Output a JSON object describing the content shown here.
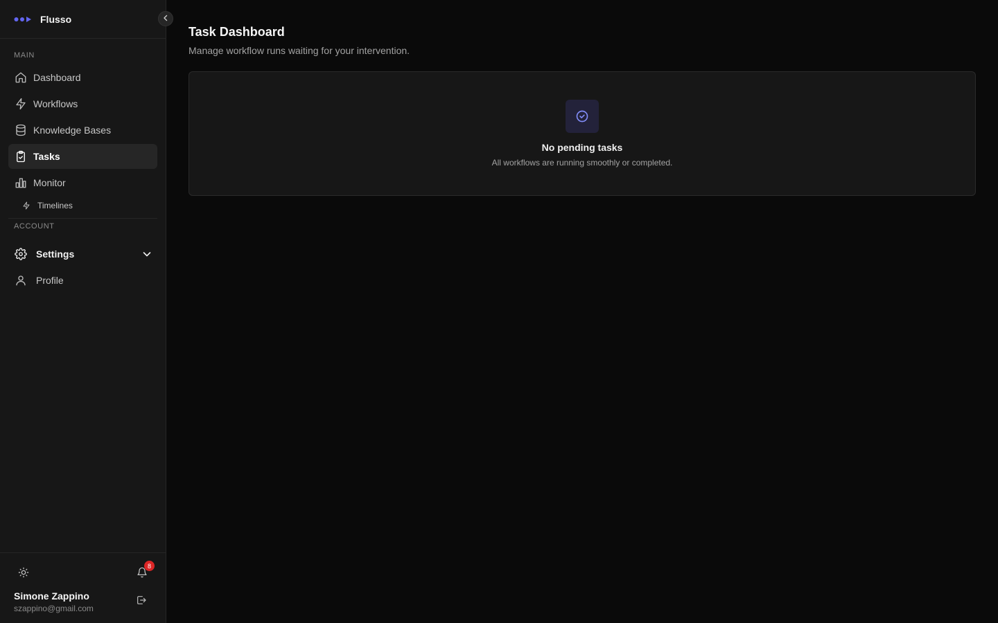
{
  "brand": {
    "name": "Flusso",
    "accent": "#6366f1"
  },
  "sidebar": {
    "main_label": "MAIN",
    "items": [
      {
        "label": "Dashboard",
        "icon": "home-icon"
      },
      {
        "label": "Workflows",
        "icon": "lightning-icon"
      },
      {
        "label": "Knowledge Bases",
        "icon": "database-icon"
      },
      {
        "label": "Tasks",
        "icon": "clipboard-check-icon",
        "active": true
      },
      {
        "label": "Monitor",
        "icon": "bar-chart-icon"
      }
    ],
    "sub_items": [
      {
        "label": "Timelines",
        "icon": "lightning-icon"
      }
    ],
    "account_label": "ACCOUNT",
    "account_items": [
      {
        "label": "Settings",
        "icon": "gear-icon",
        "expandable": true
      },
      {
        "label": "Profile",
        "icon": "user-icon"
      }
    ]
  },
  "footer": {
    "notification_count": "8",
    "user_name": "Simone Zappino",
    "user_email": "szappino@gmail.com"
  },
  "main": {
    "title": "Task Dashboard",
    "subtitle": "Manage workflow runs waiting for your intervention.",
    "empty_state": {
      "title": "No pending tasks",
      "subtitle": "All workflows are running smoothly or completed.",
      "icon": "check-circle-icon"
    }
  }
}
